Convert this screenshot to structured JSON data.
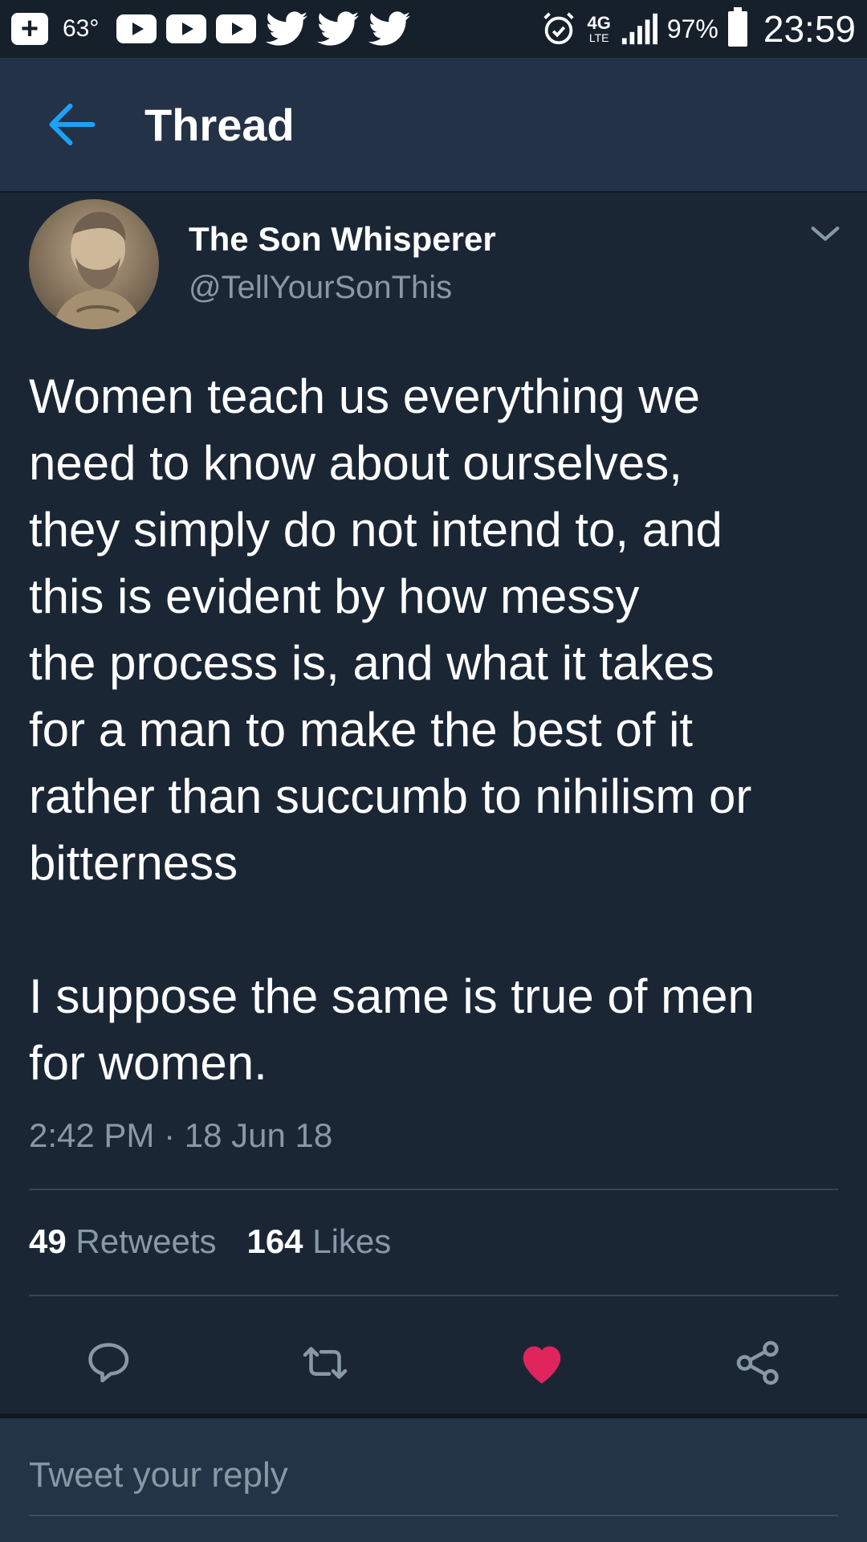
{
  "status_bar": {
    "temperature": "63°",
    "network": "4G",
    "network_sub": "LTE",
    "battery": "97%",
    "time": "23:59",
    "icons": [
      "plus-icon",
      "youtube-icon",
      "youtube-icon",
      "youtube-icon",
      "twitter-bird-icon",
      "twitter-bird-icon",
      "twitter-bird-icon",
      "alarm-icon",
      "signal-icon",
      "battery-icon"
    ]
  },
  "header": {
    "title": "Thread",
    "back_icon": "arrow-left-icon"
  },
  "tweet": {
    "author_name": "The Son Whisperer",
    "author_handle": "@TellYourSonThis",
    "text": "Women teach us everything we\nneed to know about ourselves,\nthey simply do not intend to, and\nthis is evident by how messy\nthe process is, and what it takes\nfor a man to make the best of it\nrather than succumb to nihilism or\nbitterness\n\nI suppose the same is true of men\nfor women.",
    "timestamp": "2:42 PM · 18 Jun 18",
    "retweet_count": "49",
    "retweet_label": "Retweets",
    "like_count": "164",
    "like_label": "Likes",
    "liked": true
  },
  "actions": [
    "reply-icon",
    "retweet-icon",
    "heart-icon",
    "share-icon"
  ],
  "reply": {
    "placeholder": "Tweet your reply"
  },
  "colors": {
    "background": "#1b2635",
    "header": "#233247",
    "accent": "#1da1f2",
    "like": "#e0245e",
    "secondary_text": "#8899a6"
  }
}
